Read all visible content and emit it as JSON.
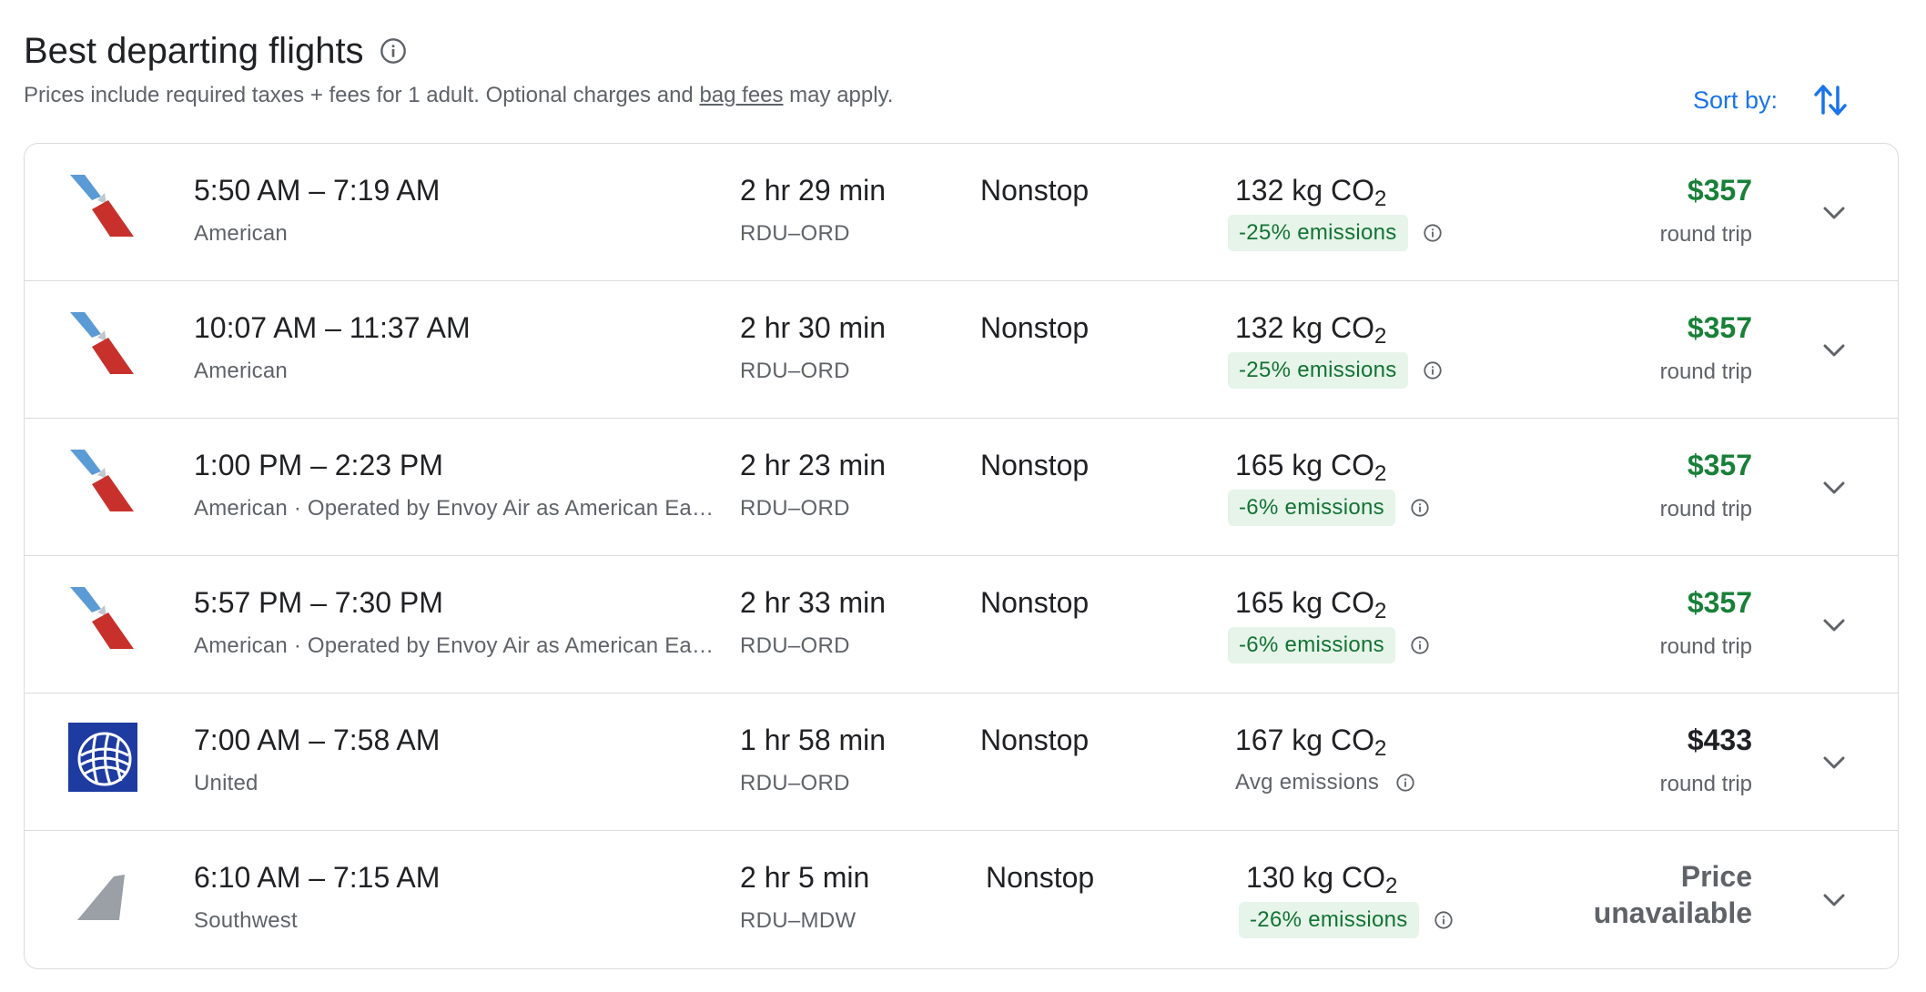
{
  "header": {
    "title": "Best departing flights",
    "subtitle_prefix": "Prices include required taxes + fees for 1 adult. Optional charges and ",
    "subtitle_link": "bag fees",
    "subtitle_suffix": " may apply.",
    "sort_label": "Sort by:"
  },
  "flights": [
    {
      "times": "5:50 AM – 7:19 AM",
      "airline": "American",
      "duration": "2 hr 29 min",
      "route": "RDU–ORD",
      "stops": "Nonstop",
      "co2_value": "132 kg CO",
      "co2_sub": "2",
      "emissions": "-25% emissions",
      "price": "$357",
      "price_type": "round trip",
      "logo": "american-airlines-logo"
    },
    {
      "times": "10:07 AM – 11:37 AM",
      "airline": "American",
      "duration": "2 hr 30 min",
      "route": "RDU–ORD",
      "stops": "Nonstop",
      "co2_value": "132 kg CO",
      "co2_sub": "2",
      "emissions": "-25% emissions",
      "price": "$357",
      "price_type": "round trip",
      "logo": "american-airlines-logo"
    },
    {
      "times": "1:00 PM – 2:23 PM",
      "airline": "American · Operated by Envoy Air as American Ea…",
      "duration": "2 hr 23 min",
      "route": "RDU–ORD",
      "stops": "Nonstop",
      "co2_value": "165 kg CO",
      "co2_sub": "2",
      "emissions": "-6% emissions",
      "price": "$357",
      "price_type": "round trip",
      "logo": "american-airlines-logo"
    },
    {
      "times": "5:57 PM – 7:30 PM",
      "airline": "American · Operated by Envoy Air as American Ea…",
      "duration": "2 hr 33 min",
      "route": "RDU–ORD",
      "stops": "Nonstop",
      "co2_value": "165 kg CO",
      "co2_sub": "2",
      "emissions": "-6% emissions",
      "price": "$357",
      "price_type": "round trip",
      "logo": "american-airlines-logo"
    },
    {
      "times": "7:00 AM – 7:58 AM",
      "airline": "United",
      "duration": "1 hr 58 min",
      "route": "RDU–ORD",
      "stops": "Nonstop",
      "co2_value": "167 kg CO",
      "co2_sub": "2",
      "emissions": "Avg emissions",
      "price": "$433",
      "price_type": "round trip",
      "logo": "united-airlines-logo"
    },
    {
      "times": "6:10 AM – 7:15 AM",
      "airline": "Southwest",
      "duration": "2 hr 5 min",
      "route": "RDU–MDW",
      "stops": "Nonstop",
      "co2_value": "130 kg CO",
      "co2_sub": "2",
      "emissions": "-26% emissions",
      "price_line1": "Price",
      "price_line2": "unavailable",
      "logo": "generic-tail-logo"
    }
  ],
  "colors": {
    "accent": "#1a73e8",
    "price_green": "#188038",
    "badge_bg": "#e6f4ea",
    "badge_text": "#137333",
    "border": "#dadce0"
  }
}
